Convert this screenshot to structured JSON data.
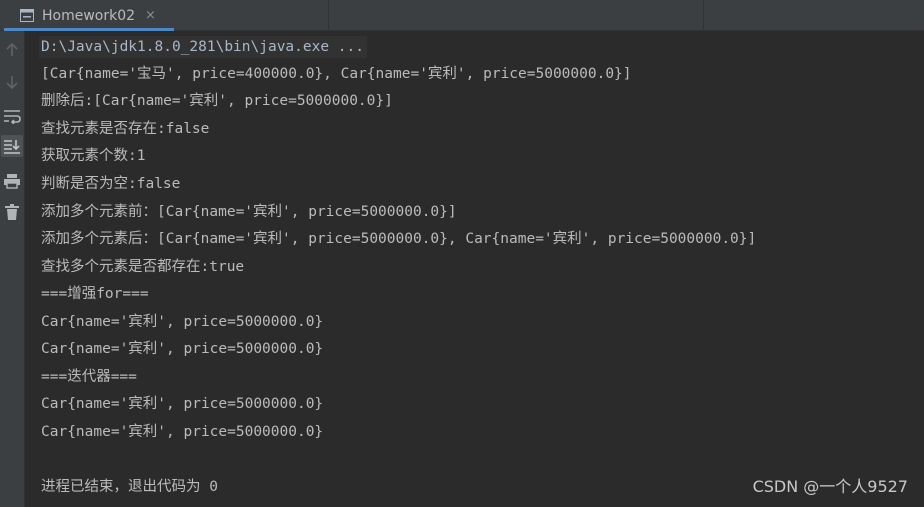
{
  "tab": {
    "title": "Homework02",
    "close_glyph": "×"
  },
  "toolbar": {
    "icons": [
      "up-arrow-icon",
      "down-arrow-icon",
      "soft-wrap-icon",
      "scroll-to-end-icon",
      "print-icon",
      "trash-icon"
    ]
  },
  "console": {
    "command": "D:\\Java\\jdk1.8.0_281\\bin\\java.exe ...",
    "lines": [
      "[Car{name='宝马', price=400000.0}, Car{name='宾利', price=5000000.0}]",
      "删除后:[Car{name='宾利', price=5000000.0}]",
      "查找元素是否存在:false",
      "获取元素个数:1",
      "判断是否为空:false",
      "添加多个元素前：[Car{name='宾利', price=5000000.0}]",
      "添加多个元素后：[Car{name='宾利', price=5000000.0}, Car{name='宾利', price=5000000.0}]",
      "查找多个元素是否都存在:true",
      "===增强for===",
      "Car{name='宾利', price=5000000.0}",
      "Car{name='宾利', price=5000000.0}",
      "===迭代器===",
      "Car{name='宾利', price=5000000.0}",
      "Car{name='宾利', price=5000000.0}"
    ],
    "exit_message": "进程已结束，退出代码为 0"
  },
  "watermark": "CSDN @一个人9527",
  "colors": {
    "background": "#2b2b2b",
    "panel": "#3c3f41",
    "text": "#bbbbbb",
    "tab_accent": "#4a88c7"
  }
}
